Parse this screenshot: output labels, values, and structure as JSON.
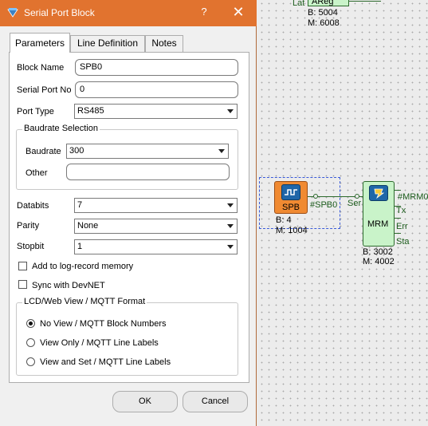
{
  "dialog": {
    "title": "Serial Port Block",
    "help_label": "?",
    "close_label": "✕",
    "tabs": [
      {
        "label": "Parameters",
        "active": true
      },
      {
        "label": "Line Definition",
        "active": false
      },
      {
        "label": "Notes",
        "active": false
      }
    ],
    "fields": {
      "block_name": {
        "label": "Block Name",
        "value": "SPB0"
      },
      "serial_port_no": {
        "label": "Serial Port No",
        "value": "0"
      },
      "port_type": {
        "label": "Port Type",
        "value": "RS485"
      }
    },
    "baudrate": {
      "title": "Baudrate Selection",
      "baudrate_label": "Baudrate",
      "baudrate_value": "300",
      "other_label": "Other",
      "other_value": ""
    },
    "databits": {
      "label": "Databits",
      "value": "7"
    },
    "parity": {
      "label": "Parity",
      "value": "None"
    },
    "stopbit": {
      "label": "Stopbit",
      "value": "1"
    },
    "checkboxes": {
      "log_record": {
        "label": "Add to log-record memory",
        "checked": false
      },
      "devnet": {
        "label": "Sync with DevNET",
        "checked": false
      }
    },
    "view_format": {
      "title": "LCD/Web View / MQTT Format",
      "options": [
        {
          "label": "No View / MQTT Block Numbers",
          "selected": true
        },
        {
          "label": "View Only / MQTT Line Labels",
          "selected": false
        },
        {
          "label": "View and Set / MQTT Line Labels",
          "selected": false
        }
      ]
    },
    "ok_label": "OK",
    "cancel_label": "Cancel"
  },
  "canvas": {
    "top_block": {
      "left_label": "Lat",
      "name": "AReg",
      "b_line": "B: 5004",
      "m_line": "M: 6008"
    },
    "spb_block": {
      "name": "SPB",
      "output_label": "#SPB0",
      "b_line": "B: 4",
      "m_line": "M: 1004",
      "color": "#f08a32"
    },
    "mrm_block": {
      "name": "MRM",
      "input_label": "Ser",
      "outputs": [
        "#MRM0",
        "Tx",
        "Err",
        "Sta"
      ],
      "b_line": "B: 3002",
      "m_line": "M: 4002",
      "color": "#c9f3c9"
    },
    "selection_color": "#3a5bd9",
    "wire_color": "#2d6a2d"
  }
}
